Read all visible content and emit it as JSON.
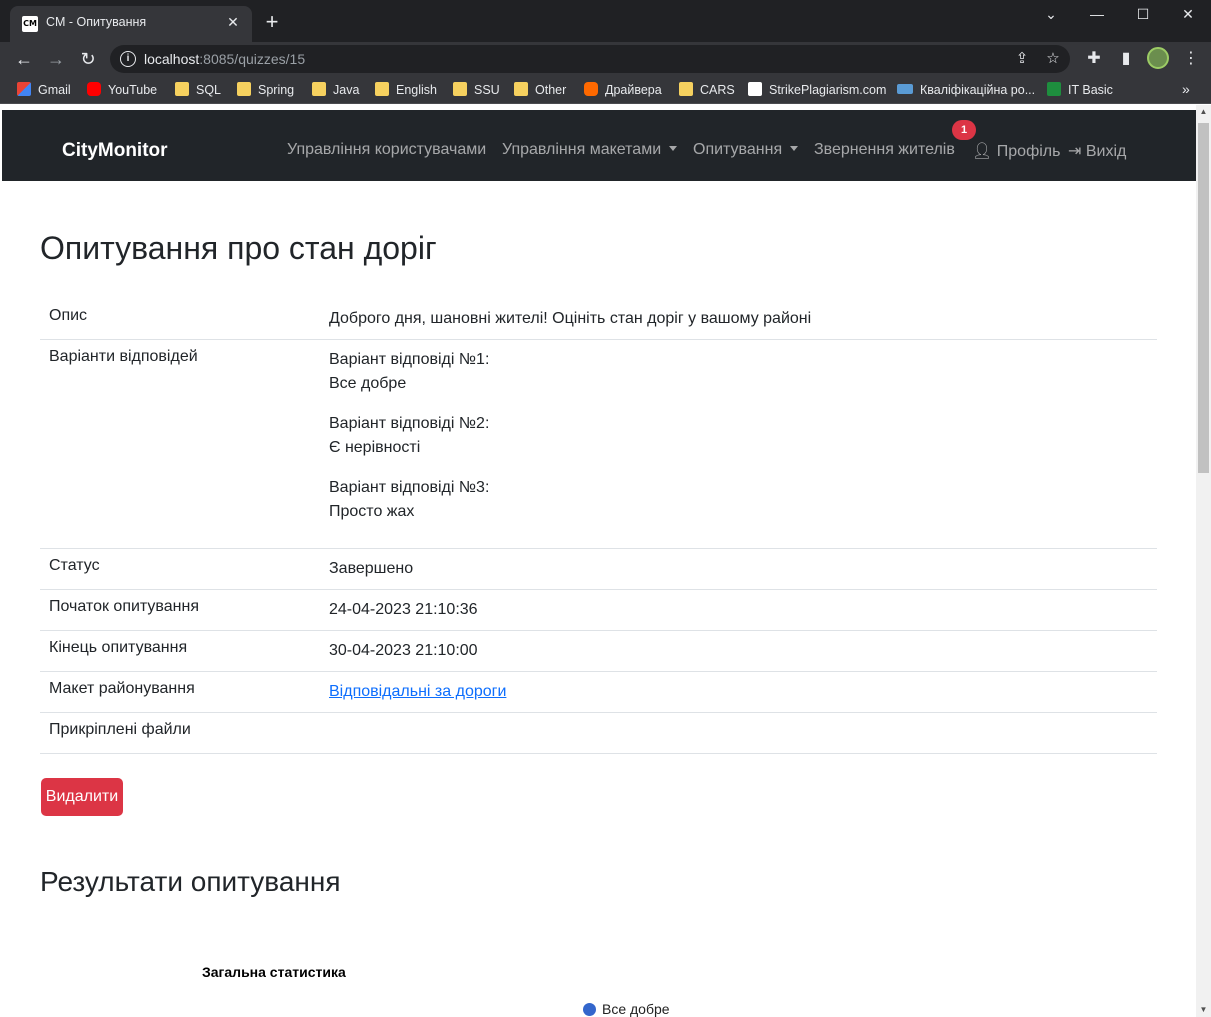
{
  "browser": {
    "tab_title": "CM - Опитування",
    "tab_favicon_text": "CM",
    "url_host": "localhost",
    "url_rest": ":8085/quizzes/15",
    "bookmarks": [
      {
        "label": "Gmail",
        "icon": "gmail-icon"
      },
      {
        "label": "YouTube",
        "icon": "youtube-icon"
      },
      {
        "label": "SQL",
        "icon": "folder-icon"
      },
      {
        "label": "Spring",
        "icon": "folder-icon"
      },
      {
        "label": "Java",
        "icon": "folder-icon"
      },
      {
        "label": "English",
        "icon": "folder-icon"
      },
      {
        "label": "SSU",
        "icon": "folder-icon"
      },
      {
        "label": "Other",
        "icon": "folder-icon"
      },
      {
        "label": "Драйвера",
        "icon": "mi-icon"
      },
      {
        "label": "CARS",
        "icon": "folder-icon"
      },
      {
        "label": "StrikePlagiarism.com",
        "icon": "document-icon"
      },
      {
        "label": "Кваліфікаційна ро...",
        "icon": "site-icon"
      },
      {
        "label": "IT Basic",
        "icon": "classroom-icon"
      }
    ]
  },
  "navbar": {
    "brand": "CityMonitor",
    "links": {
      "users": "Управління користувачами",
      "layouts": "Управління макетами",
      "quizzes": "Опитування",
      "appeals": "Звернення жителів",
      "profile": "Профіль",
      "logout": "Вихід"
    },
    "appeals_badge": "1"
  },
  "quiz": {
    "title": "Опитування про стан доріг",
    "rows": {
      "description_label": "Опис",
      "description_value": "Доброго дня, шановні жителі! Оцініть стан доріг у вашому районі",
      "options_label": "Варіанти відповідей",
      "options": [
        {
          "heading": "Варіант відповіді №1:",
          "text": "Все добре"
        },
        {
          "heading": "Варіант відповіді №2:",
          "text": "Є нерівності"
        },
        {
          "heading": "Варіант відповіді №3:",
          "text": "Просто жах"
        }
      ],
      "status_label": "Статус",
      "status_value": "Завершено",
      "start_label": "Початок опитування",
      "start_value": "24-04-2023 21:10:36",
      "end_label": "Кінець опитування",
      "end_value": "30-04-2023 21:10:00",
      "layout_label": "Макет районування",
      "layout_value": "Відповідальні за дороги",
      "files_label": "Прикріплені файли"
    },
    "delete_button": "Видалити"
  },
  "results": {
    "title": "Результати опитування",
    "chart_title": "Загальна статистика",
    "legend": [
      {
        "label": "Все добре",
        "color": "#3366cc"
      }
    ]
  },
  "colors": {
    "navbar_bg": "#212529",
    "danger": "#dc3545",
    "link": "#0d6efd"
  }
}
